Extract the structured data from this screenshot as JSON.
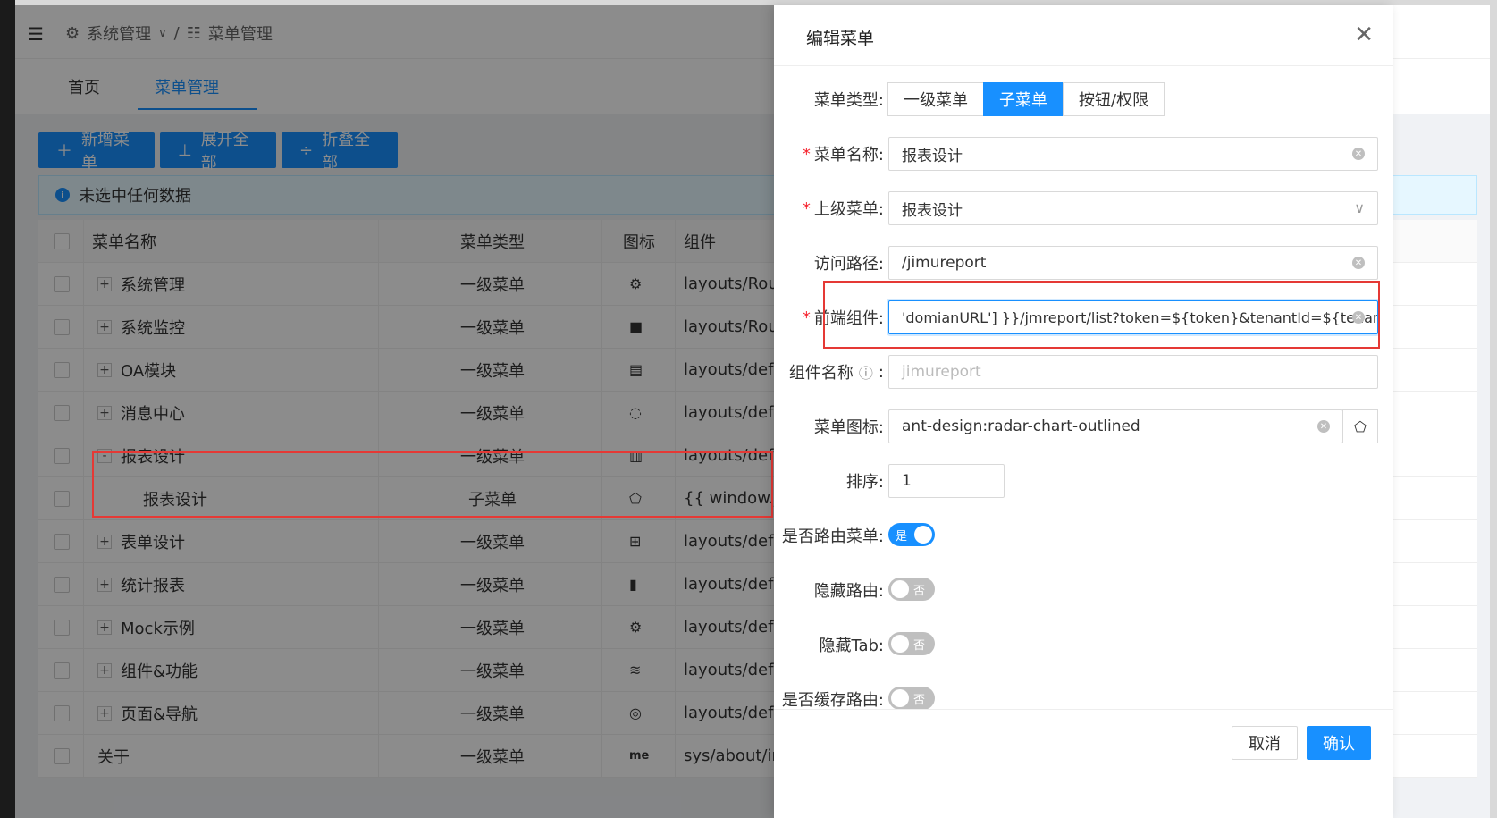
{
  "breadcrumb": {
    "first": "系统管理",
    "second": "菜单管理"
  },
  "tabs": [
    {
      "label": "首页"
    },
    {
      "label": "菜单管理"
    }
  ],
  "toolbar": {
    "add": "新增菜单",
    "expand": "展开全部",
    "collapse": "折叠全部"
  },
  "alert": {
    "text": "未选中任何数据"
  },
  "table": {
    "headers": {
      "name": "菜单名称",
      "type": "菜单类型",
      "icon": "图标",
      "component": "组件"
    },
    "rows": [
      {
        "expander": "+",
        "name": "系统管理",
        "type": "一级菜单",
        "icon": "⚙",
        "component": "layouts/Route"
      },
      {
        "expander": "+",
        "name": "系统监控",
        "type": "一级菜单",
        "icon": "■",
        "component": "layouts/Route"
      },
      {
        "expander": "+",
        "name": "OA模块",
        "type": "一级菜单",
        "icon": "▤",
        "component": "layouts/defau"
      },
      {
        "expander": "+",
        "name": "消息中心",
        "type": "一级菜单",
        "icon": "◌",
        "component": "layouts/defau"
      },
      {
        "expander": "-",
        "name": "报表设计",
        "type": "一级菜单",
        "icon": "▥",
        "component": "layouts/defau"
      },
      {
        "expander": "",
        "name": "报表设计",
        "type": "子菜单",
        "icon": "⬠",
        "component": "{{ window._CC"
      },
      {
        "expander": "+",
        "name": "表单设计",
        "type": "一级菜单",
        "icon": "⊞",
        "component": "layouts/defau"
      },
      {
        "expander": "+",
        "name": "统计报表",
        "type": "一级菜单",
        "icon": "▮",
        "component": "layouts/defau"
      },
      {
        "expander": "+",
        "name": "Mock示例",
        "type": "一级菜单",
        "icon": "⚙",
        "component": "layouts/defau"
      },
      {
        "expander": "+",
        "name": "组件&功能",
        "type": "一级菜单",
        "icon": "≋",
        "component": "layouts/defau"
      },
      {
        "expander": "+",
        "name": "页面&导航",
        "type": "一级菜单",
        "icon": "◎",
        "component": "layouts/defau"
      },
      {
        "expander": "",
        "name": "关于",
        "type": "一级菜单",
        "icon": "me",
        "component": "sys/about/ind"
      }
    ]
  },
  "drawer": {
    "title": "编辑菜单",
    "menu_type": {
      "label": "菜单类型:",
      "options": [
        "一级菜单",
        "子菜单",
        "按钮/权限"
      ],
      "selected": "子菜单"
    },
    "menu_name": {
      "label": "菜单名称:",
      "value": "报表设计"
    },
    "parent_menu": {
      "label": "上级菜单:",
      "value": "报表设计"
    },
    "path": {
      "label": "访问路径:",
      "value": "/jimureport"
    },
    "component": {
      "label": "前端组件:",
      "value": "'domianURL'] }}/jmreport/list?token=${token}&tenantId=${tenantId}"
    },
    "component_name": {
      "label": "组件名称",
      "placeholder": "jimureport"
    },
    "menu_icon": {
      "label": "菜单图标:",
      "value": "ant-design:radar-chart-outlined"
    },
    "sort": {
      "label": "排序:",
      "value": "1"
    },
    "is_route": {
      "label": "是否路由菜单:",
      "state": "是"
    },
    "hide_route": {
      "label": "隐藏路由:",
      "state": "否"
    },
    "hide_tab": {
      "label": "隐藏Tab:",
      "state": "否"
    },
    "keep_alive": {
      "label": "是否缓存路由:",
      "state": "否"
    },
    "cancel": "取消",
    "ok": "确认"
  }
}
